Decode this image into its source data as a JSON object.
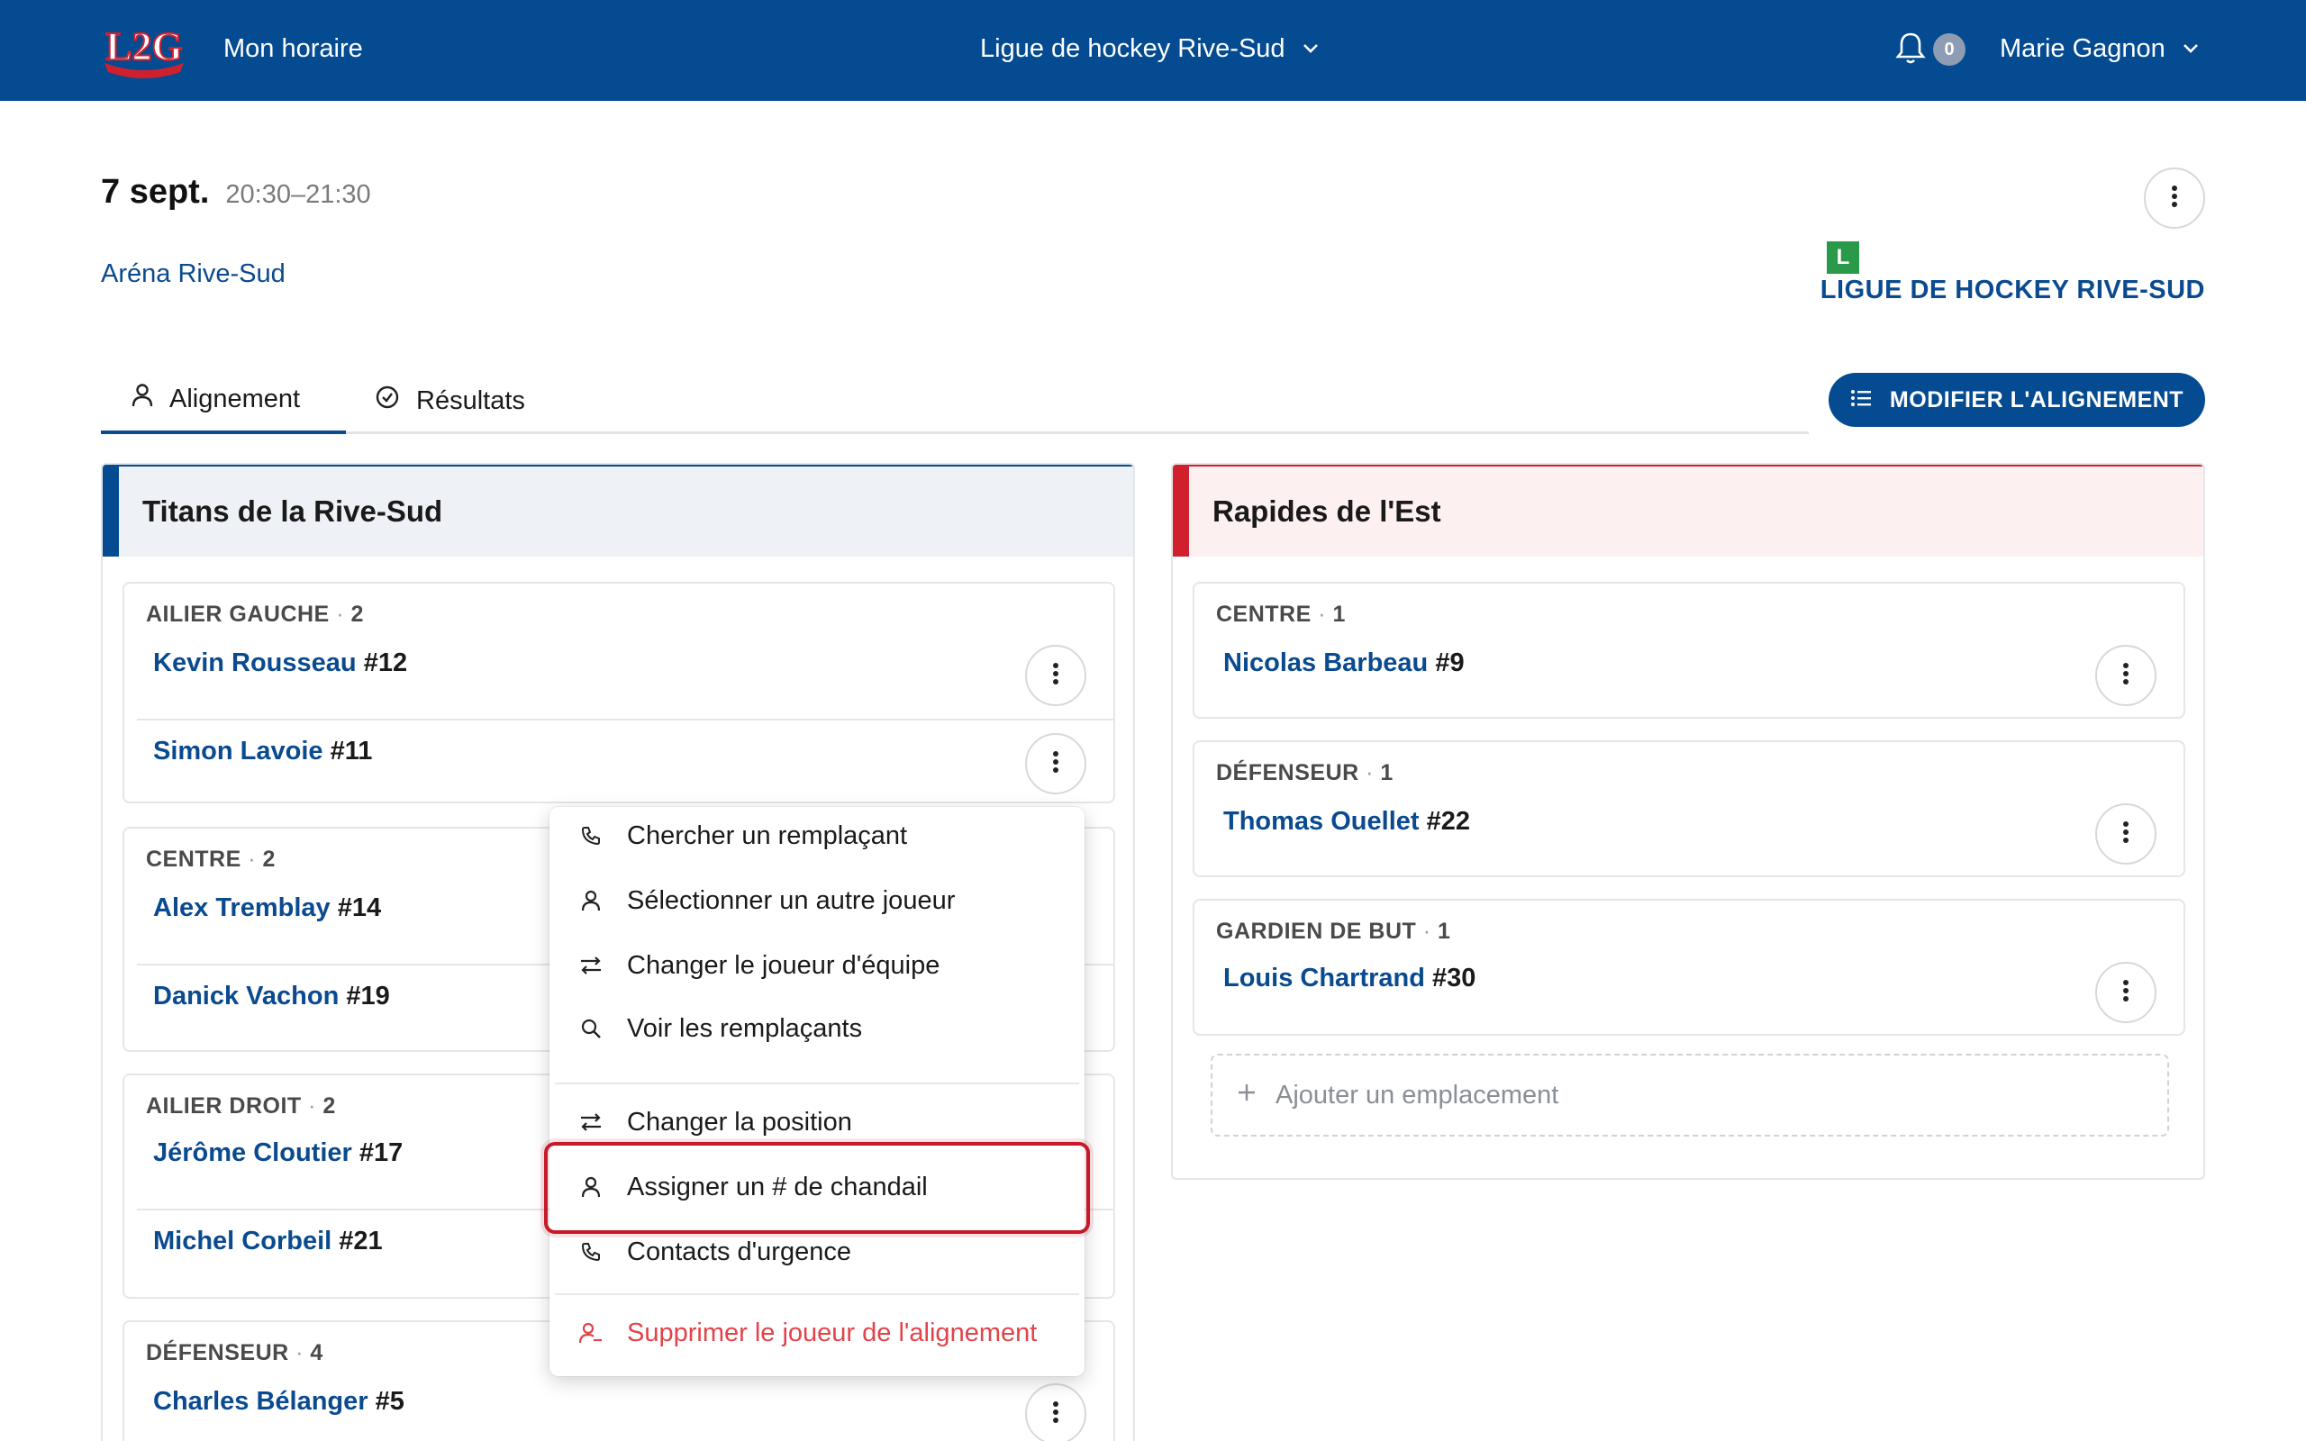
{
  "topbar": {
    "logo_text": "L2G",
    "app_title": "Mon horaire",
    "league": "Ligue de hockey Rive-Sud",
    "notification_count": "0",
    "user_name": "Marie Gagnon"
  },
  "event": {
    "date": "7 sept.",
    "time": "20:30–21:30",
    "venue": "Aréna Rive-Sud",
    "league_badge": "L",
    "league_name": "LIGUE DE HOCKEY RIVE-SUD"
  },
  "tabs": [
    {
      "label": "Alignement",
      "active": true
    },
    {
      "label": "Résultats",
      "active": false
    }
  ],
  "edit_button": "MODIFIER L'ALIGNEMENT",
  "home_team": {
    "name": "Titans de la Rive-Sud",
    "color": "#044b91",
    "positions": [
      {
        "label": "AILIER GAUCHE",
        "count": "2",
        "players": [
          {
            "name": "Kevin Rousseau",
            "number": "#12"
          },
          {
            "name": "Simon Lavoie",
            "number": "#11"
          }
        ]
      },
      {
        "label": "CENTRE",
        "count": "2",
        "players": [
          {
            "name": "Alex Tremblay",
            "number": "#14"
          },
          {
            "name": "Danick Vachon",
            "number": "#19"
          }
        ]
      },
      {
        "label": "AILIER DROIT",
        "count": "2",
        "players": [
          {
            "name": "Jérôme Cloutier",
            "number": "#17"
          },
          {
            "name": "Michel Corbeil",
            "number": "#21"
          }
        ]
      },
      {
        "label": "DÉFENSEUR",
        "count": "4",
        "players": [
          {
            "name": "Charles Bélanger",
            "number": "#5"
          }
        ]
      }
    ]
  },
  "away_team": {
    "name": "Rapides de l'Est",
    "color": "#d0202e",
    "positions": [
      {
        "label": "CENTRE",
        "count": "1",
        "players": [
          {
            "name": "Nicolas Barbeau",
            "number": "#9"
          }
        ]
      },
      {
        "label": "DÉFENSEUR",
        "count": "1",
        "players": [
          {
            "name": "Thomas Ouellet",
            "number": "#22"
          }
        ]
      },
      {
        "label": "GARDIEN DE BUT",
        "count": "1",
        "players": [
          {
            "name": "Louis Chartrand",
            "number": "#30"
          }
        ]
      }
    ],
    "add_slot": "Ajouter un emplacement"
  },
  "context_menu": {
    "items": [
      {
        "label": "Chercher un remplaçant",
        "icon": "phone-icon"
      },
      {
        "label": "Sélectionner un autre joueur",
        "icon": "person-icon"
      },
      {
        "label": "Changer le joueur d'équipe",
        "icon": "swap-icon"
      },
      {
        "label": "Voir les remplaçants",
        "icon": "search-icon"
      },
      {
        "label": "Changer la position",
        "icon": "swap-icon"
      },
      {
        "label": "Assigner un # de chandail",
        "icon": "person-icon",
        "highlighted": true
      },
      {
        "label": "Contacts d'urgence",
        "icon": "phone-icon"
      },
      {
        "label": "Supprimer le joueur de l'alignement",
        "icon": "person-remove-icon",
        "danger": true
      }
    ]
  },
  "colors": {
    "brand": "#044b91",
    "danger": "#d0202e",
    "link": "#0a4a8f"
  }
}
